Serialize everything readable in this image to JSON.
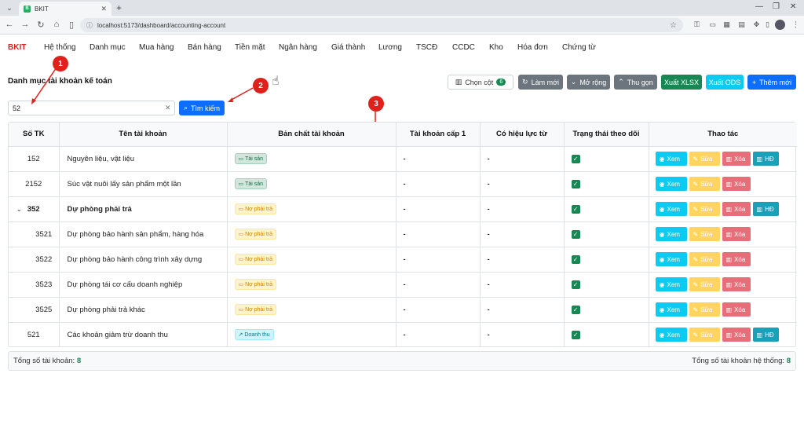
{
  "browser": {
    "tab_title": "BKIT",
    "favicon_letter": "B",
    "url": "localhost:5173/dashboard/accounting-account"
  },
  "app": {
    "brand": "BKIT",
    "menu": [
      "Hệ thống",
      "Danh mục",
      "Mua hàng",
      "Bán hàng",
      "Tiền mặt",
      "Ngân hàng",
      "Giá thành",
      "Lương",
      "TSCĐ",
      "CCDC",
      "Kho",
      "Hóa đơn",
      "Chứng từ"
    ]
  },
  "page": {
    "title": "Danh mục tài khoản kế toán",
    "toolbar": {
      "choose_columns": "Chọn cột",
      "column_count": "6",
      "refresh": "Làm mới",
      "expand": "Mở rộng",
      "collapse": "Thu gọn",
      "export_xlsx": "Xuất XLSX",
      "export_ods": "Xuất ODS",
      "add_new": "Thêm mới"
    },
    "search": {
      "value": "52",
      "button": "Tìm kiếm"
    }
  },
  "annotations": [
    "1",
    "2",
    "3"
  ],
  "table": {
    "headers": [
      "Số TK",
      "Tên tài khoản",
      "Bản chất tài khoản",
      "Tài khoản cấp 1",
      "Có hiệu lực từ",
      "Trạng thái theo dõi",
      "Thao tác"
    ],
    "rows": [
      {
        "code": "152",
        "name": "Nguyên liệu, vật liệu",
        "nature": "Tài sản",
        "level1": "-",
        "effective": "-",
        "level": "top",
        "hd": "HĐ"
      },
      {
        "code": "2152",
        "name": "Súc vật nuôi lấy sản phẩm một lần",
        "nature": "Tài sản",
        "level1": "-",
        "effective": "-",
        "level": "top",
        "hd": ""
      },
      {
        "code": "352",
        "name": "Dự phòng phải trả",
        "nature": "Nợ phải trả",
        "level1": "-",
        "effective": "-",
        "level": "parent",
        "hd": "HĐ"
      },
      {
        "code": "3521",
        "name": "Dự phòng bảo hành sản phẩm, hàng hóa",
        "nature": "Nợ phải trả",
        "level1": "-",
        "effective": "-",
        "level": "child",
        "hd": ""
      },
      {
        "code": "3522",
        "name": "Dự phòng bảo hành công trình xây dựng",
        "nature": "Nợ phải trả",
        "level1": "-",
        "effective": "-",
        "level": "child",
        "hd": ""
      },
      {
        "code": "3523",
        "name": "Dự phòng tái cơ cấu doanh nghiệp",
        "nature": "Nợ phải trả",
        "level1": "-",
        "effective": "-",
        "level": "child",
        "hd": ""
      },
      {
        "code": "3525",
        "name": "Dự phòng phải trả khác",
        "nature": "Nợ phải trả",
        "level1": "-",
        "effective": "-",
        "level": "child",
        "hd": ""
      },
      {
        "code": "521",
        "name": "Các khoản giảm trừ doanh thu",
        "nature": "Doanh thu",
        "level1": "-",
        "effective": "-",
        "level": "top",
        "hd": "HĐ"
      }
    ],
    "actions": {
      "view": "Xem",
      "edit": "Sửa",
      "delete": "Xóa"
    }
  },
  "footer": {
    "total_label": "Tổng số tài khoản:",
    "total_value": "8",
    "system_label": "Tổng số tài khoản hệ thống:",
    "system_value": "8"
  }
}
